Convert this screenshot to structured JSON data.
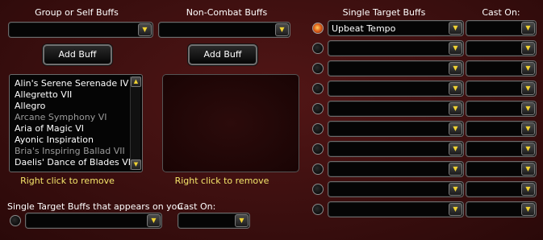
{
  "group_buffs": {
    "header": "Group or Self Buffs",
    "dropdown_value": "",
    "add_button": "Add Buff",
    "list_items": [
      {
        "label": "Alin's Serene Serenade IV",
        "dim": false
      },
      {
        "label": "Allegretto VII",
        "dim": false
      },
      {
        "label": "Allegro",
        "dim": false
      },
      {
        "label": "Arcane Symphony VI",
        "dim": true
      },
      {
        "label": "Aria of Magic VI",
        "dim": false
      },
      {
        "label": "Ayonic Inspiration",
        "dim": false
      },
      {
        "label": "Bria's Inspiring Ballad VII",
        "dim": true
      },
      {
        "label": "Daelis' Dance of Blades VII",
        "dim": false
      }
    ],
    "remove_hint": "Right click to remove"
  },
  "noncombat_buffs": {
    "header": "Non-Combat Buffs",
    "dropdown_value": "",
    "add_button": "Add Buff",
    "remove_hint": "Right click to remove"
  },
  "single_target": {
    "header": "Single Target Buffs",
    "cast_on_header": "Cast On:",
    "rows": [
      {
        "buff": "Upbeat Tempo",
        "cast_on": "",
        "selected": true
      },
      {
        "buff": "",
        "cast_on": "",
        "selected": false
      },
      {
        "buff": "",
        "cast_on": "",
        "selected": false
      },
      {
        "buff": "",
        "cast_on": "",
        "selected": false
      },
      {
        "buff": "",
        "cast_on": "",
        "selected": false
      },
      {
        "buff": "",
        "cast_on": "",
        "selected": false
      },
      {
        "buff": "",
        "cast_on": "",
        "selected": false
      },
      {
        "buff": "",
        "cast_on": "",
        "selected": false
      },
      {
        "buff": "",
        "cast_on": "",
        "selected": false
      },
      {
        "buff": "",
        "cast_on": "",
        "selected": false
      }
    ]
  },
  "appears_on_you": {
    "label": "Single Target Buffs that appears on you",
    "dropdown_value": "",
    "cast_on_label": "Cast On:",
    "cast_on_value": ""
  },
  "icons": {
    "dropdown_arrow": "chevron-down-icon",
    "scroll_up": "scroll-up-arrow-icon",
    "scroll_down": "scroll-down-arrow-icon"
  },
  "colors": {
    "background": "#3c0f0f",
    "hint_text": "#f4e56a",
    "arrow_accent": "#f0d232"
  }
}
